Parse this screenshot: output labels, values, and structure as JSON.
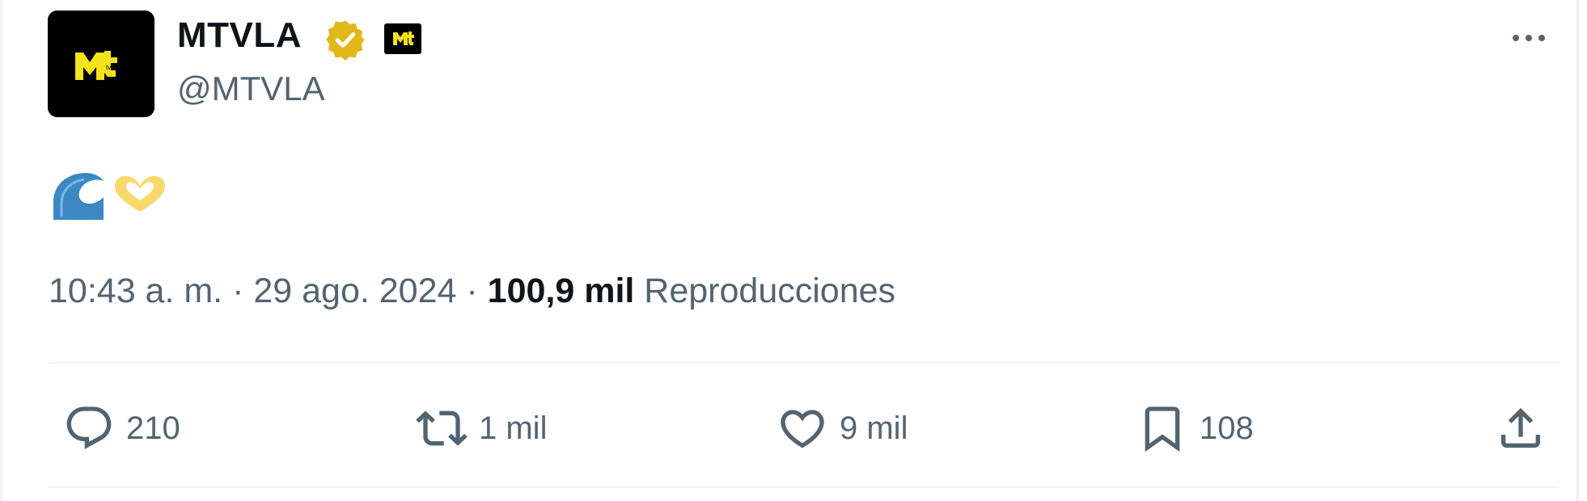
{
  "tweet": {
    "author": {
      "display_name": "MTVLA",
      "handle": "@MTVLA",
      "avatar_icon": "mtv-logo-icon",
      "verified_icon": "verified-gold-badge-icon",
      "affiliate_icon": "mtv-affiliate-badge-icon"
    },
    "body_emojis": [
      "wave-emoji",
      "heart-hands-emoji"
    ],
    "meta": {
      "time": "10:43 a. m.",
      "separator": " · ",
      "date": "29 ago. 2024",
      "views_count": "100,9 mil",
      "views_label": "Reproducciones"
    },
    "actions": {
      "replies": "210",
      "retweets": "1 mil",
      "likes": "9 mil",
      "bookmarks": "108"
    }
  },
  "colors": {
    "text_primary": "#0f1419",
    "text_secondary": "#536471",
    "divider": "#eff3f4",
    "verified_gold": "#e2b719",
    "mtv_yellow": "#f5e21b",
    "wave_blue": "#3b88c3",
    "heart_yellow": "#f9d86b"
  }
}
